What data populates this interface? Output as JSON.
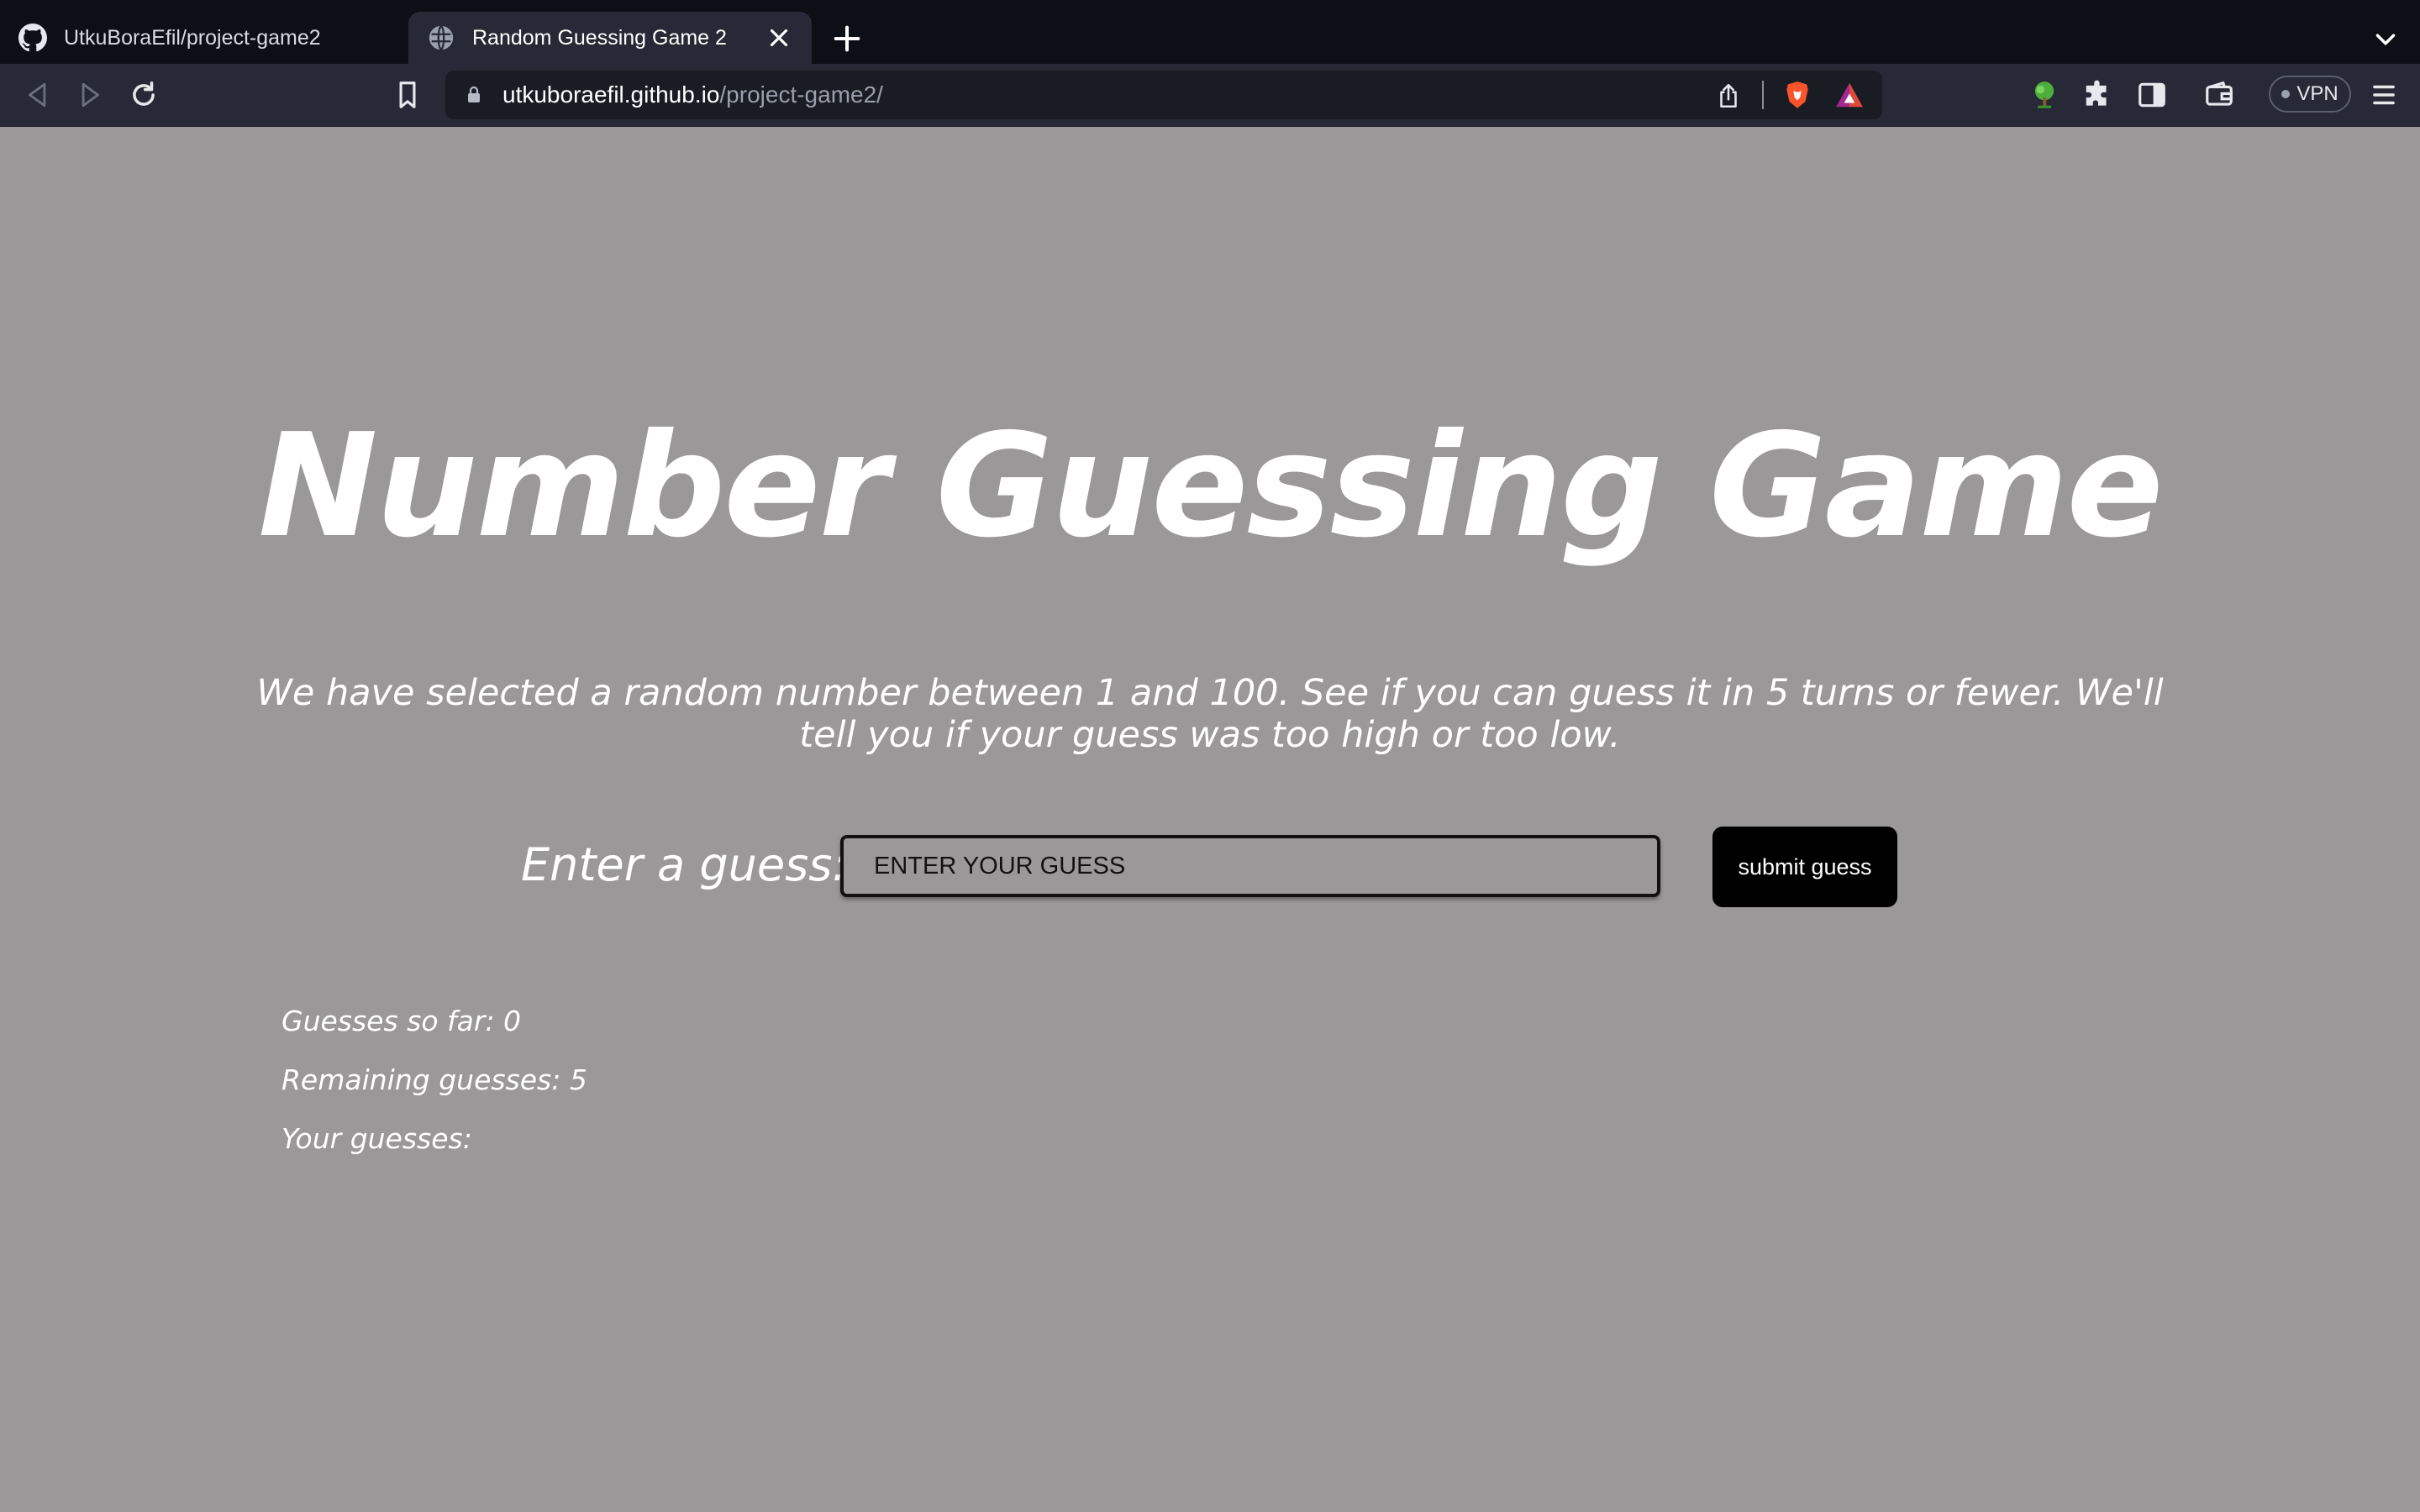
{
  "browser": {
    "tabs": [
      {
        "title": "UtkuBoraEfil/project-game2",
        "icon": "github-icon",
        "active": false
      },
      {
        "title": "Random Guessing Game 2",
        "icon": "globe-icon",
        "active": true
      }
    ],
    "url": {
      "host": "utkuboraefil.github.io",
      "path": "/project-game2/"
    },
    "vpn_label": "VPN"
  },
  "page": {
    "title": "Number Guessing Game",
    "intro": "We have selected a random number between 1 and 100. See if you can guess it in 5 turns or fewer. We'll tell you if your guess was too high or too low.",
    "guess_label": "Enter a guess:",
    "guess_placeholder": "ENTER YOUR GUESS",
    "guess_value": "",
    "submit_label": "submit guess",
    "stats": {
      "guesses_so_far": "Guesses so far: 0",
      "remaining": "Remaining guesses: 5",
      "your_guesses": "Your guesses:"
    }
  },
  "colors": {
    "page_background": "#9a9899",
    "tabstrip_background": "#0d0f17",
    "toolbar_background": "#272a36",
    "button_background": "#000000",
    "text": "#ffffff"
  }
}
